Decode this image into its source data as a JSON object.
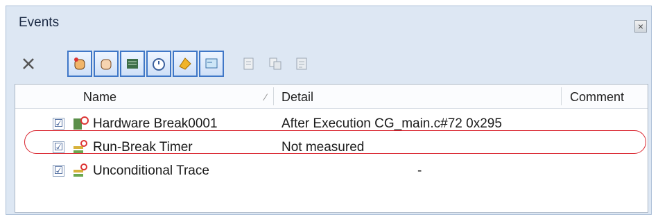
{
  "panel": {
    "title": "Events",
    "close_label": "×"
  },
  "toolbar": {
    "delete_label": "✕",
    "buttons": [
      {
        "name": "filter-hardware-break",
        "icon": "hand-stop-icon",
        "selected": true
      },
      {
        "name": "filter-software-break",
        "icon": "hand-icon",
        "selected": true
      },
      {
        "name": "filter-trace",
        "icon": "trace-icon",
        "selected": true
      },
      {
        "name": "filter-timer",
        "icon": "timer-icon",
        "selected": true
      },
      {
        "name": "filter-action",
        "icon": "action-icon",
        "selected": true
      },
      {
        "name": "filter-other",
        "icon": "window-icon",
        "selected": true
      },
      {
        "name": "edit-event",
        "icon": "edit-icon",
        "selected": false
      },
      {
        "name": "copy-event",
        "icon": "copy-icon",
        "selected": false
      },
      {
        "name": "properties-event",
        "icon": "properties-icon",
        "selected": false
      }
    ]
  },
  "table": {
    "columns": {
      "name": "Name",
      "sort_marker": "⁄",
      "detail": "Detail",
      "comment": "Comment"
    },
    "rows": [
      {
        "checked": "☑",
        "name": "Hardware Break0001",
        "detail": "After Execution  CG_main.c#72 0x295",
        "icon": "hardware-break-icon"
      },
      {
        "checked": "☑",
        "name": "Run-Break Timer",
        "detail": "Not measured",
        "icon": "timer-event-icon"
      },
      {
        "checked": "☑",
        "name": "Unconditional Trace",
        "detail": "-",
        "icon": "trace-event-icon"
      }
    ]
  },
  "colors": {
    "highlight": "#d9232d",
    "selected_border": "#3f77c7"
  }
}
